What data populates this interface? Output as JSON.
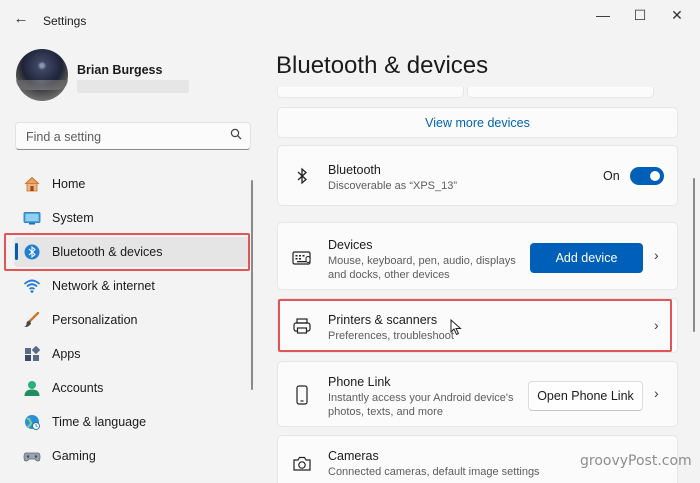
{
  "window": {
    "title": "Settings",
    "back_glyph": "←",
    "minimize_glyph": "—",
    "maximize_glyph": "☐",
    "close_glyph": "✕"
  },
  "user": {
    "name": "Brian Burgess"
  },
  "search": {
    "placeholder": "Find a setting"
  },
  "sidebar": {
    "items": [
      {
        "label": "Home",
        "icon": "home-icon"
      },
      {
        "label": "System",
        "icon": "system-icon"
      },
      {
        "label": "Bluetooth & devices",
        "icon": "bluetooth-icon",
        "active": true
      },
      {
        "label": "Network & internet",
        "icon": "wifi-icon"
      },
      {
        "label": "Personalization",
        "icon": "brush-icon"
      },
      {
        "label": "Apps",
        "icon": "apps-icon"
      },
      {
        "label": "Accounts",
        "icon": "accounts-icon"
      },
      {
        "label": "Time & language",
        "icon": "globe-icon"
      },
      {
        "label": "Gaming",
        "icon": "gamepad-icon"
      }
    ]
  },
  "main": {
    "page_title": "Bluetooth & devices",
    "view_more": "View more devices",
    "bluetooth": {
      "title": "Bluetooth",
      "desc": "Discoverable as “XPS_13”",
      "state": "On"
    },
    "devices": {
      "title": "Devices",
      "desc": "Mouse, keyboard, pen, audio, displays and docks, other devices",
      "button": "Add device"
    },
    "printers": {
      "title": "Printers & scanners",
      "desc": "Preferences, troubleshoot"
    },
    "phone": {
      "title": "Phone Link",
      "desc": "Instantly access your Android device's photos, texts, and more",
      "button": "Open Phone Link"
    },
    "cameras": {
      "title": "Cameras",
      "desc": "Connected cameras, default image settings"
    },
    "chevron_glyph": "›"
  },
  "colors": {
    "accent": "#005fb8",
    "highlight": "#e05555",
    "link": "#0063b1"
  },
  "watermark": "groovyPost.com"
}
